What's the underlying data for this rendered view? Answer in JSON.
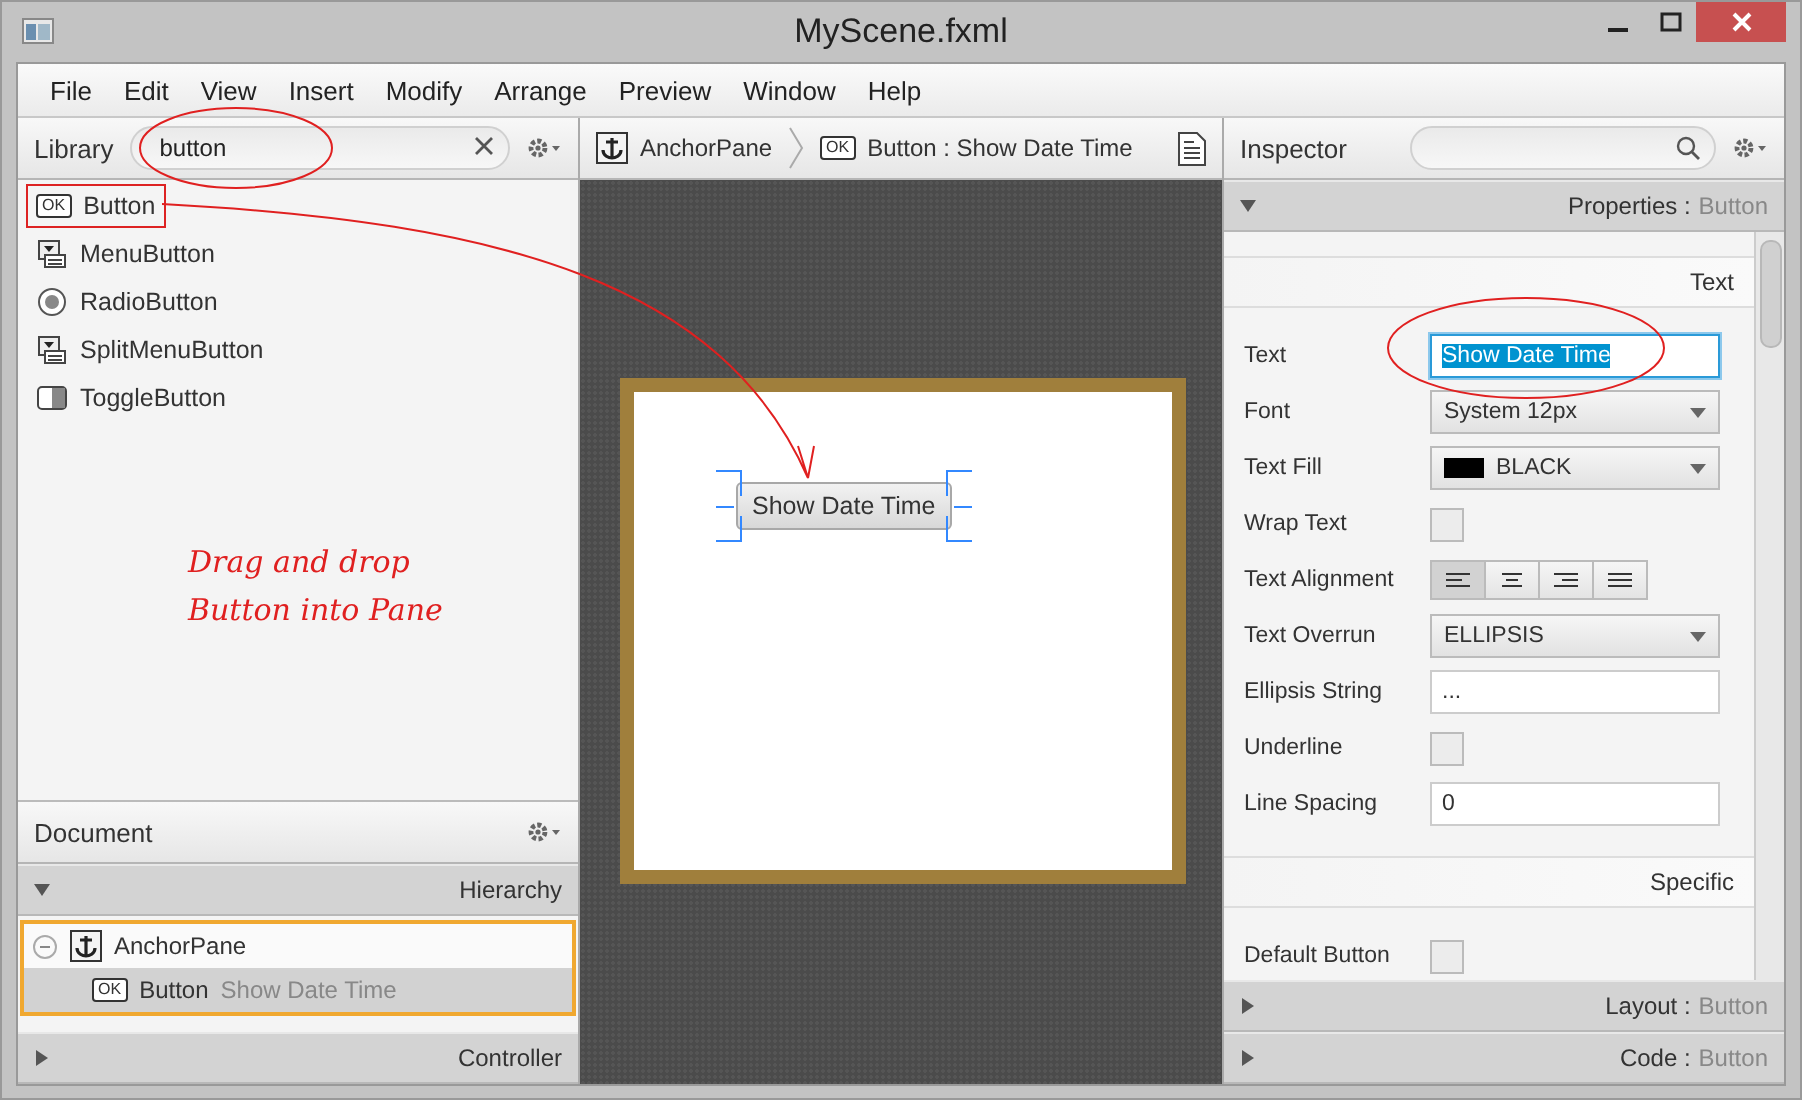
{
  "window": {
    "title": "MyScene.fxml"
  },
  "menu": [
    "File",
    "Edit",
    "View",
    "Insert",
    "Modify",
    "Arrange",
    "Preview",
    "Window",
    "Help"
  ],
  "library": {
    "title": "Library",
    "search": {
      "value": "button"
    },
    "items": [
      {
        "label": "Button",
        "kind": "ok",
        "badge": "OK",
        "marked": true
      },
      {
        "label": "MenuButton",
        "kind": "menu",
        "marked": false
      },
      {
        "label": "RadioButton",
        "kind": "radio",
        "marked": false
      },
      {
        "label": "SplitMenuButton",
        "kind": "menu",
        "marked": false
      },
      {
        "label": "ToggleButton",
        "kind": "toggle",
        "marked": false
      }
    ]
  },
  "annotation": {
    "lines": [
      "Drag and drop",
      "Button into Pane"
    ]
  },
  "breadcrumb": [
    {
      "label": "AnchorPane",
      "kind": "anchor"
    },
    {
      "label": "Button : Show Date Time",
      "kind": "ok",
      "badge": "OK"
    }
  ],
  "canvas": {
    "button": {
      "label": "Show Date Time",
      "selected": true
    }
  },
  "document": {
    "title": "Document",
    "sections": [
      {
        "title": "Hierarchy",
        "expanded": true
      },
      {
        "title": "Controller",
        "expanded": false
      }
    ],
    "tree": [
      {
        "label": "AnchorPane",
        "kind": "anchor",
        "expanded": true,
        "selected": false,
        "children": [
          {
            "label": "Button",
            "detail": "Show Date Time",
            "kind": "ok",
            "badge": "OK",
            "selected": true
          }
        ]
      }
    ]
  },
  "inspector": {
    "title": "Inspector",
    "sections": [
      {
        "title": "Properties :",
        "target": "Button",
        "expanded": true
      },
      {
        "title": "Layout :",
        "target": "Button",
        "expanded": false
      },
      {
        "title": "Code :",
        "target": "Button",
        "expanded": false
      }
    ],
    "groups": [
      {
        "title": "Text",
        "rows": [
          {
            "label": "Text",
            "kind": "text",
            "value": "Show Date Time",
            "focused": true
          },
          {
            "label": "Font",
            "kind": "select",
            "value": "System 12px"
          },
          {
            "label": "Text Fill",
            "kind": "color",
            "value": "BLACK",
            "color": "#000000"
          },
          {
            "label": "Wrap Text",
            "kind": "checkbox",
            "checked": false
          },
          {
            "label": "Text Alignment",
            "kind": "align",
            "options": [
              {
                "selected": true
              },
              {
                "selected": false
              },
              {
                "selected": false
              },
              {
                "selected": false
              }
            ]
          },
          {
            "label": "Text Overrun",
            "kind": "select",
            "value": "ELLIPSIS"
          },
          {
            "label": "Ellipsis String",
            "kind": "text",
            "value": "...",
            "focused": false
          },
          {
            "label": "Underline",
            "kind": "checkbox",
            "checked": false
          },
          {
            "label": "Line Spacing",
            "kind": "text",
            "value": "0",
            "focused": false
          }
        ]
      },
      {
        "title": "Specific",
        "rows": [
          {
            "label": "Default Button",
            "kind": "checkbox",
            "checked": false
          }
        ]
      }
    ]
  }
}
